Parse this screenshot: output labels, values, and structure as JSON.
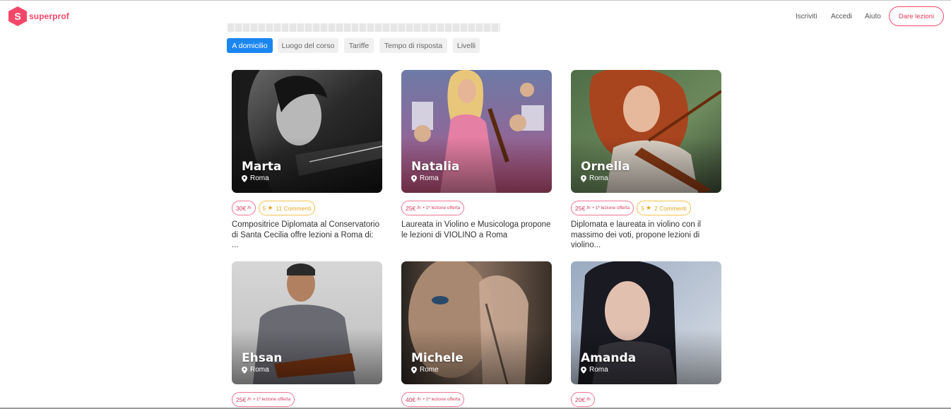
{
  "header": {
    "logo_letter": "S",
    "logo_text": "superprof",
    "nav": {
      "iscriviti": "Iscriviti",
      "accedi": "Accedi",
      "aiuto": "Aiuto"
    },
    "cta": "Dare lezioni"
  },
  "filters": [
    {
      "label": "A domicilio",
      "active": true
    },
    {
      "label": "Luogo del corso",
      "active": false
    },
    {
      "label": "Tariffe",
      "active": false
    },
    {
      "label": "Tempo di risposta",
      "active": false
    },
    {
      "label": "Livelli",
      "active": false
    }
  ],
  "teachers": [
    {
      "name": "Marta",
      "location": "Roma",
      "price": "30€",
      "per": "/h",
      "offer": "",
      "rating": "5",
      "reviews": "11 Commenti",
      "description": "Compositrice Diplomata al Conservatorio di Santa Cecilia offre lezioni a Roma di: ..."
    },
    {
      "name": "Natalia",
      "location": "Roma",
      "price": "25€",
      "per": "/h",
      "offer": "• 1ª lezione offerta",
      "rating": "",
      "reviews": "",
      "description": "Laureata in Violino e Musicologa propone le lezioni di VIOLINO a Roma"
    },
    {
      "name": "Ornella",
      "location": "Roma",
      "price": "25€",
      "per": "/h",
      "offer": "• 1ª lezione offerta",
      "rating": "5",
      "reviews": "2 Commenti",
      "description": "Diplomata e laureata in violino con il massimo dei voti, propone lezioni di violino..."
    },
    {
      "name": "Ehsan",
      "location": "Roma",
      "price": "25€",
      "per": "/h",
      "offer": "• 1ª lezione offerta",
      "rating": "",
      "reviews": "",
      "description": ""
    },
    {
      "name": "Michele",
      "location": "Rome",
      "price": "40€",
      "per": "/h",
      "offer": "• 1ª lezione offerta",
      "rating": "",
      "reviews": "",
      "description": ""
    },
    {
      "name": "Amanda",
      "location": "Roma",
      "price": "20€",
      "per": "/h",
      "offer": "",
      "rating": "",
      "reviews": "",
      "description": ""
    }
  ],
  "colors": {
    "brand": "#f3476a",
    "active_filter": "#1b86f0",
    "rating": "#e5a521"
  },
  "icons": {
    "pin": "map-pin-icon",
    "star": "star-icon",
    "logo": "superprof-logo-icon"
  }
}
